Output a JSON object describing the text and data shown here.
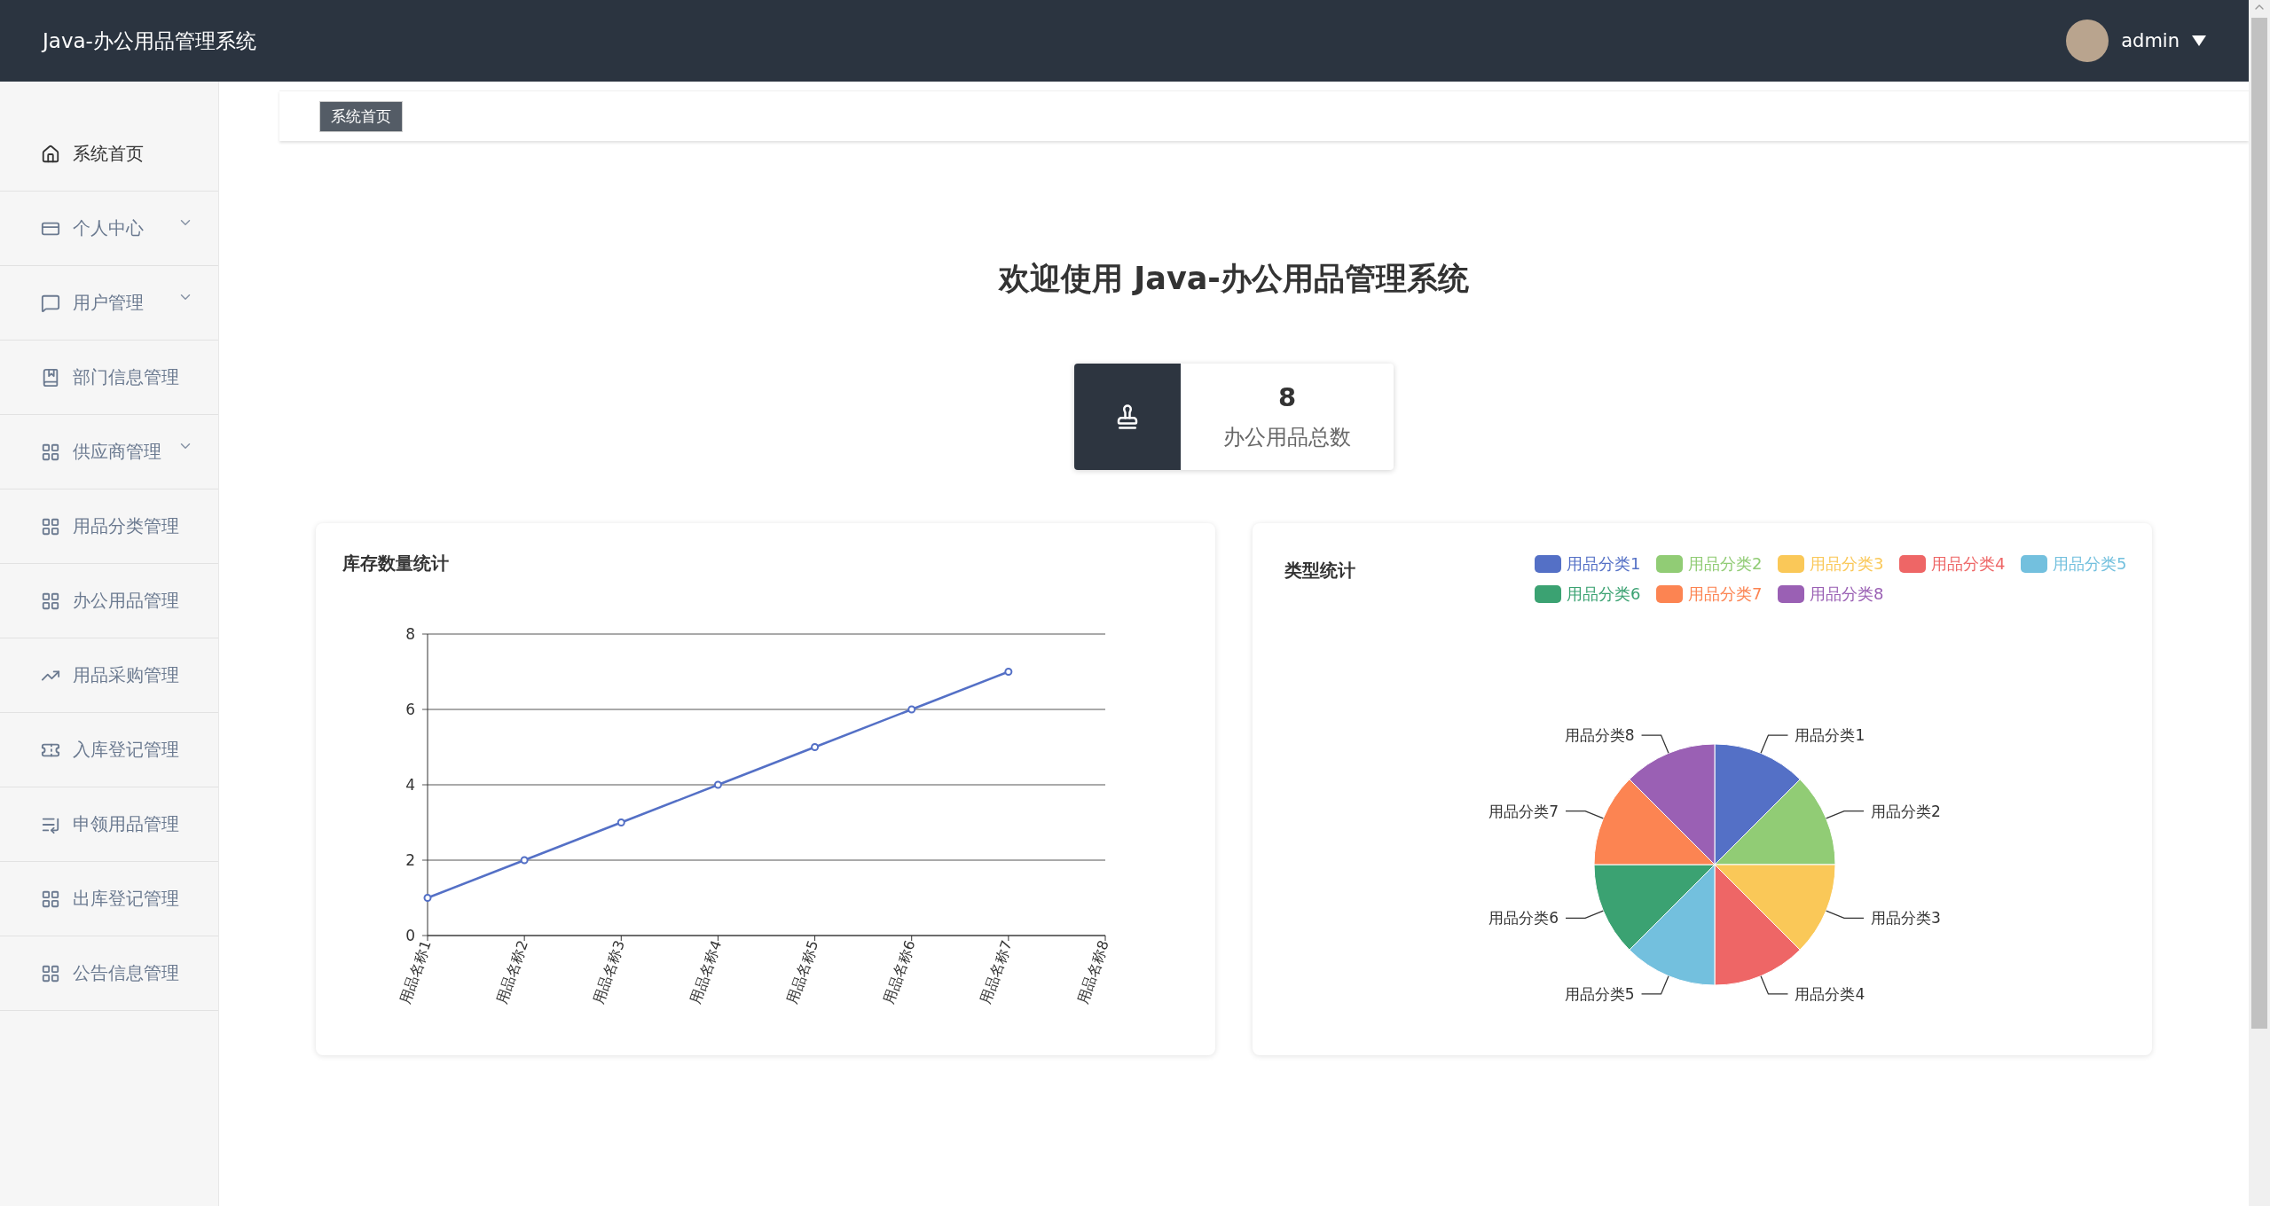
{
  "header": {
    "title": "Java-办公用品管理系统",
    "user": "admin"
  },
  "sidebar": {
    "items": [
      {
        "label": "系统首页",
        "selected": true,
        "expandable": false
      },
      {
        "label": "个人中心",
        "selected": false,
        "expandable": true
      },
      {
        "label": "用户管理",
        "selected": false,
        "expandable": true
      },
      {
        "label": "部门信息管理",
        "selected": false,
        "expandable": false
      },
      {
        "label": "供应商管理",
        "selected": false,
        "expandable": true
      },
      {
        "label": "用品分类管理",
        "selected": false,
        "expandable": false
      },
      {
        "label": "办公用品管理",
        "selected": false,
        "expandable": false
      },
      {
        "label": "用品采购管理",
        "selected": false,
        "expandable": false
      },
      {
        "label": "入库登记管理",
        "selected": false,
        "expandable": false
      },
      {
        "label": "申领用品管理",
        "selected": false,
        "expandable": false
      },
      {
        "label": "出库登记管理",
        "selected": false,
        "expandable": false
      },
      {
        "label": "公告信息管理",
        "selected": false,
        "expandable": false
      }
    ]
  },
  "breadcrumb": {
    "tabs": [
      {
        "label": "系统首页",
        "selected": true
      }
    ]
  },
  "welcome": "欢迎使用 Java-办公用品管理系统",
  "stat": {
    "value": "8",
    "label": "办公用品总数"
  },
  "stock_chart": {
    "title": "库存数量统计",
    "chart_data": {
      "type": "line",
      "categories": [
        "用品名称1",
        "用品名称2",
        "用品名称3",
        "用品名称4",
        "用品名称5",
        "用品名称6",
        "用品名称7",
        "用品名称8"
      ],
      "series": [
        {
          "color": "#5470c6",
          "marker": true,
          "values": [
            1,
            2,
            3,
            4,
            5,
            6,
            7,
            null
          ]
        }
      ],
      "grid": true,
      "ylim": [
        0,
        8
      ],
      "yticks": [
        0,
        2,
        4,
        6,
        8
      ]
    }
  },
  "type_chart": {
    "title": "类型统计",
    "legend": [
      {
        "label": "用品分类1",
        "color": "#5470c6"
      },
      {
        "label": "用品分类2",
        "color": "#91cc75"
      },
      {
        "label": "用品分类3",
        "color": "#fac858"
      },
      {
        "label": "用品分类4",
        "color": "#ee6666"
      },
      {
        "label": "用品分类5",
        "color": "#73c0de"
      },
      {
        "label": "用品分类6",
        "color": "#3ba272"
      },
      {
        "label": "用品分类7",
        "color": "#fc8452"
      },
      {
        "label": "用品分类8",
        "color": "#9a60b4"
      }
    ],
    "chart_data": {
      "type": "pie",
      "categories": [
        "用品分类1",
        "用品分类2",
        "用品分类3",
        "用品分类4",
        "用品分类5",
        "用品分类6",
        "用品分类7",
        "用品分类8"
      ],
      "values": [
        1,
        1,
        1,
        1,
        1,
        1,
        1,
        1
      ]
    }
  }
}
